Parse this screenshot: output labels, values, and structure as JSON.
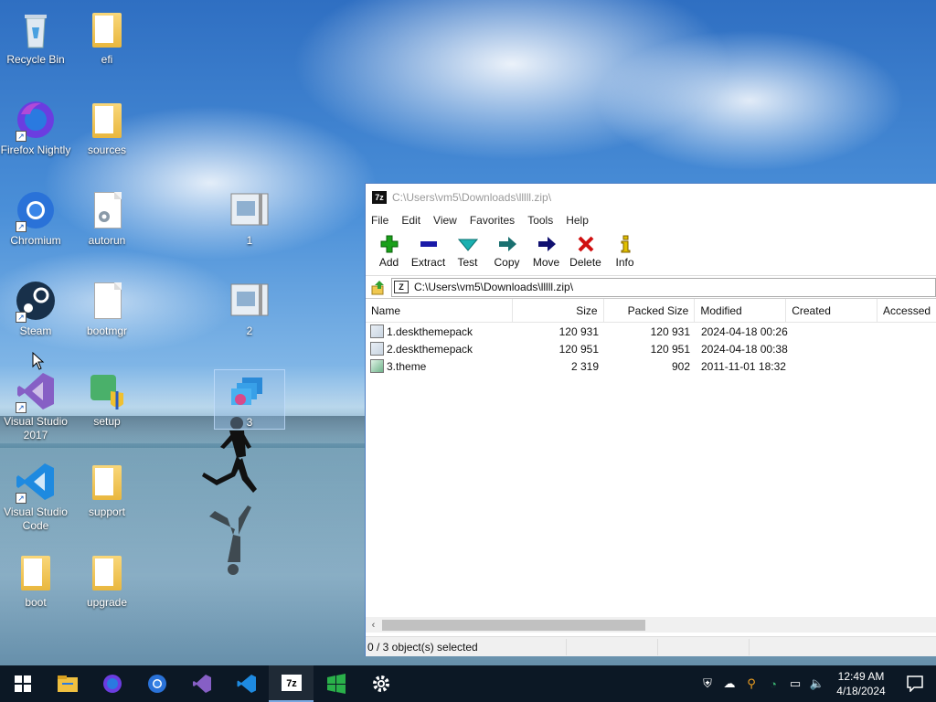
{
  "desktop": {
    "icons": [
      {
        "label": "Recycle Bin",
        "icon": "recycle-bin-icon"
      },
      {
        "label": "efi",
        "icon": "folder-icon"
      },
      {
        "label": "Firefox Nightly",
        "icon": "firefox-nightly-icon"
      },
      {
        "label": "sources",
        "icon": "folder-icon"
      },
      {
        "label": "Chromium",
        "icon": "chromium-icon"
      },
      {
        "label": "autorun",
        "icon": "settings-file-icon"
      },
      {
        "label": "1",
        "icon": "zip-archive-icon"
      },
      {
        "label": "Steam",
        "icon": "steam-icon"
      },
      {
        "label": "bootmgr",
        "icon": "file-icon"
      },
      {
        "label": "2",
        "icon": "zip-archive-icon"
      },
      {
        "label": "Visual Studio 2017",
        "icon": "visual-studio-icon"
      },
      {
        "label": "setup",
        "icon": "setup-icon"
      },
      {
        "label": "3",
        "icon": "theme-file-icon"
      },
      {
        "label": "Visual Studio Code",
        "icon": "vscode-icon"
      },
      {
        "label": "support",
        "icon": "folder-icon"
      },
      {
        "label": "boot",
        "icon": "folder-icon"
      },
      {
        "label": "upgrade",
        "icon": "folder-icon"
      }
    ]
  },
  "window": {
    "title": "C:\\Users\\vm5\\Downloads\\lllll.zip\\",
    "app_icon_text": "7z",
    "menu": [
      "File",
      "Edit",
      "View",
      "Favorites",
      "Tools",
      "Help"
    ],
    "toolbar": [
      {
        "label": "Add",
        "icon": "add-icon",
        "color": "#1aa01a"
      },
      {
        "label": "Extract",
        "icon": "extract-icon",
        "color": "#1a1aa8"
      },
      {
        "label": "Test",
        "icon": "test-icon",
        "color": "#1ab0b0"
      },
      {
        "label": "Copy",
        "icon": "copy-icon",
        "color": "#1a7070"
      },
      {
        "label": "Move",
        "icon": "move-icon",
        "color": "#101070"
      },
      {
        "label": "Delete",
        "icon": "delete-icon",
        "color": "#d01010"
      },
      {
        "label": "Info",
        "icon": "info-icon",
        "color": "#e0c000"
      }
    ],
    "address": "C:\\Users\\vm5\\Downloads\\lllll.zip\\",
    "columns": [
      "Name",
      "Size",
      "Packed Size",
      "Modified",
      "Created",
      "Accessed"
    ],
    "rows": [
      {
        "name": "1.deskthemepack",
        "size": "120 931",
        "packed": "120 931",
        "modified": "2024-04-18 00:26",
        "icon": "deskthemepack-icon"
      },
      {
        "name": "2.deskthemepack",
        "size": "120 951",
        "packed": "120 951",
        "modified": "2024-04-18 00:38",
        "icon": "deskthemepack-icon"
      },
      {
        "name": "3.theme",
        "size": "2 319",
        "packed": "902",
        "modified": "2011-11-01 18:32",
        "icon": "theme-file-icon"
      }
    ],
    "status": "0 / 3 object(s) selected"
  },
  "taskbar": {
    "items": [
      "start-icon",
      "file-explorer-icon",
      "firefox-nightly-icon",
      "chromium-icon",
      "visual-studio-icon",
      "vscode-icon",
      "7zip-icon",
      "setup-icon",
      "settings-icon"
    ],
    "time": "12:49 AM",
    "date": "4/18/2024"
  }
}
